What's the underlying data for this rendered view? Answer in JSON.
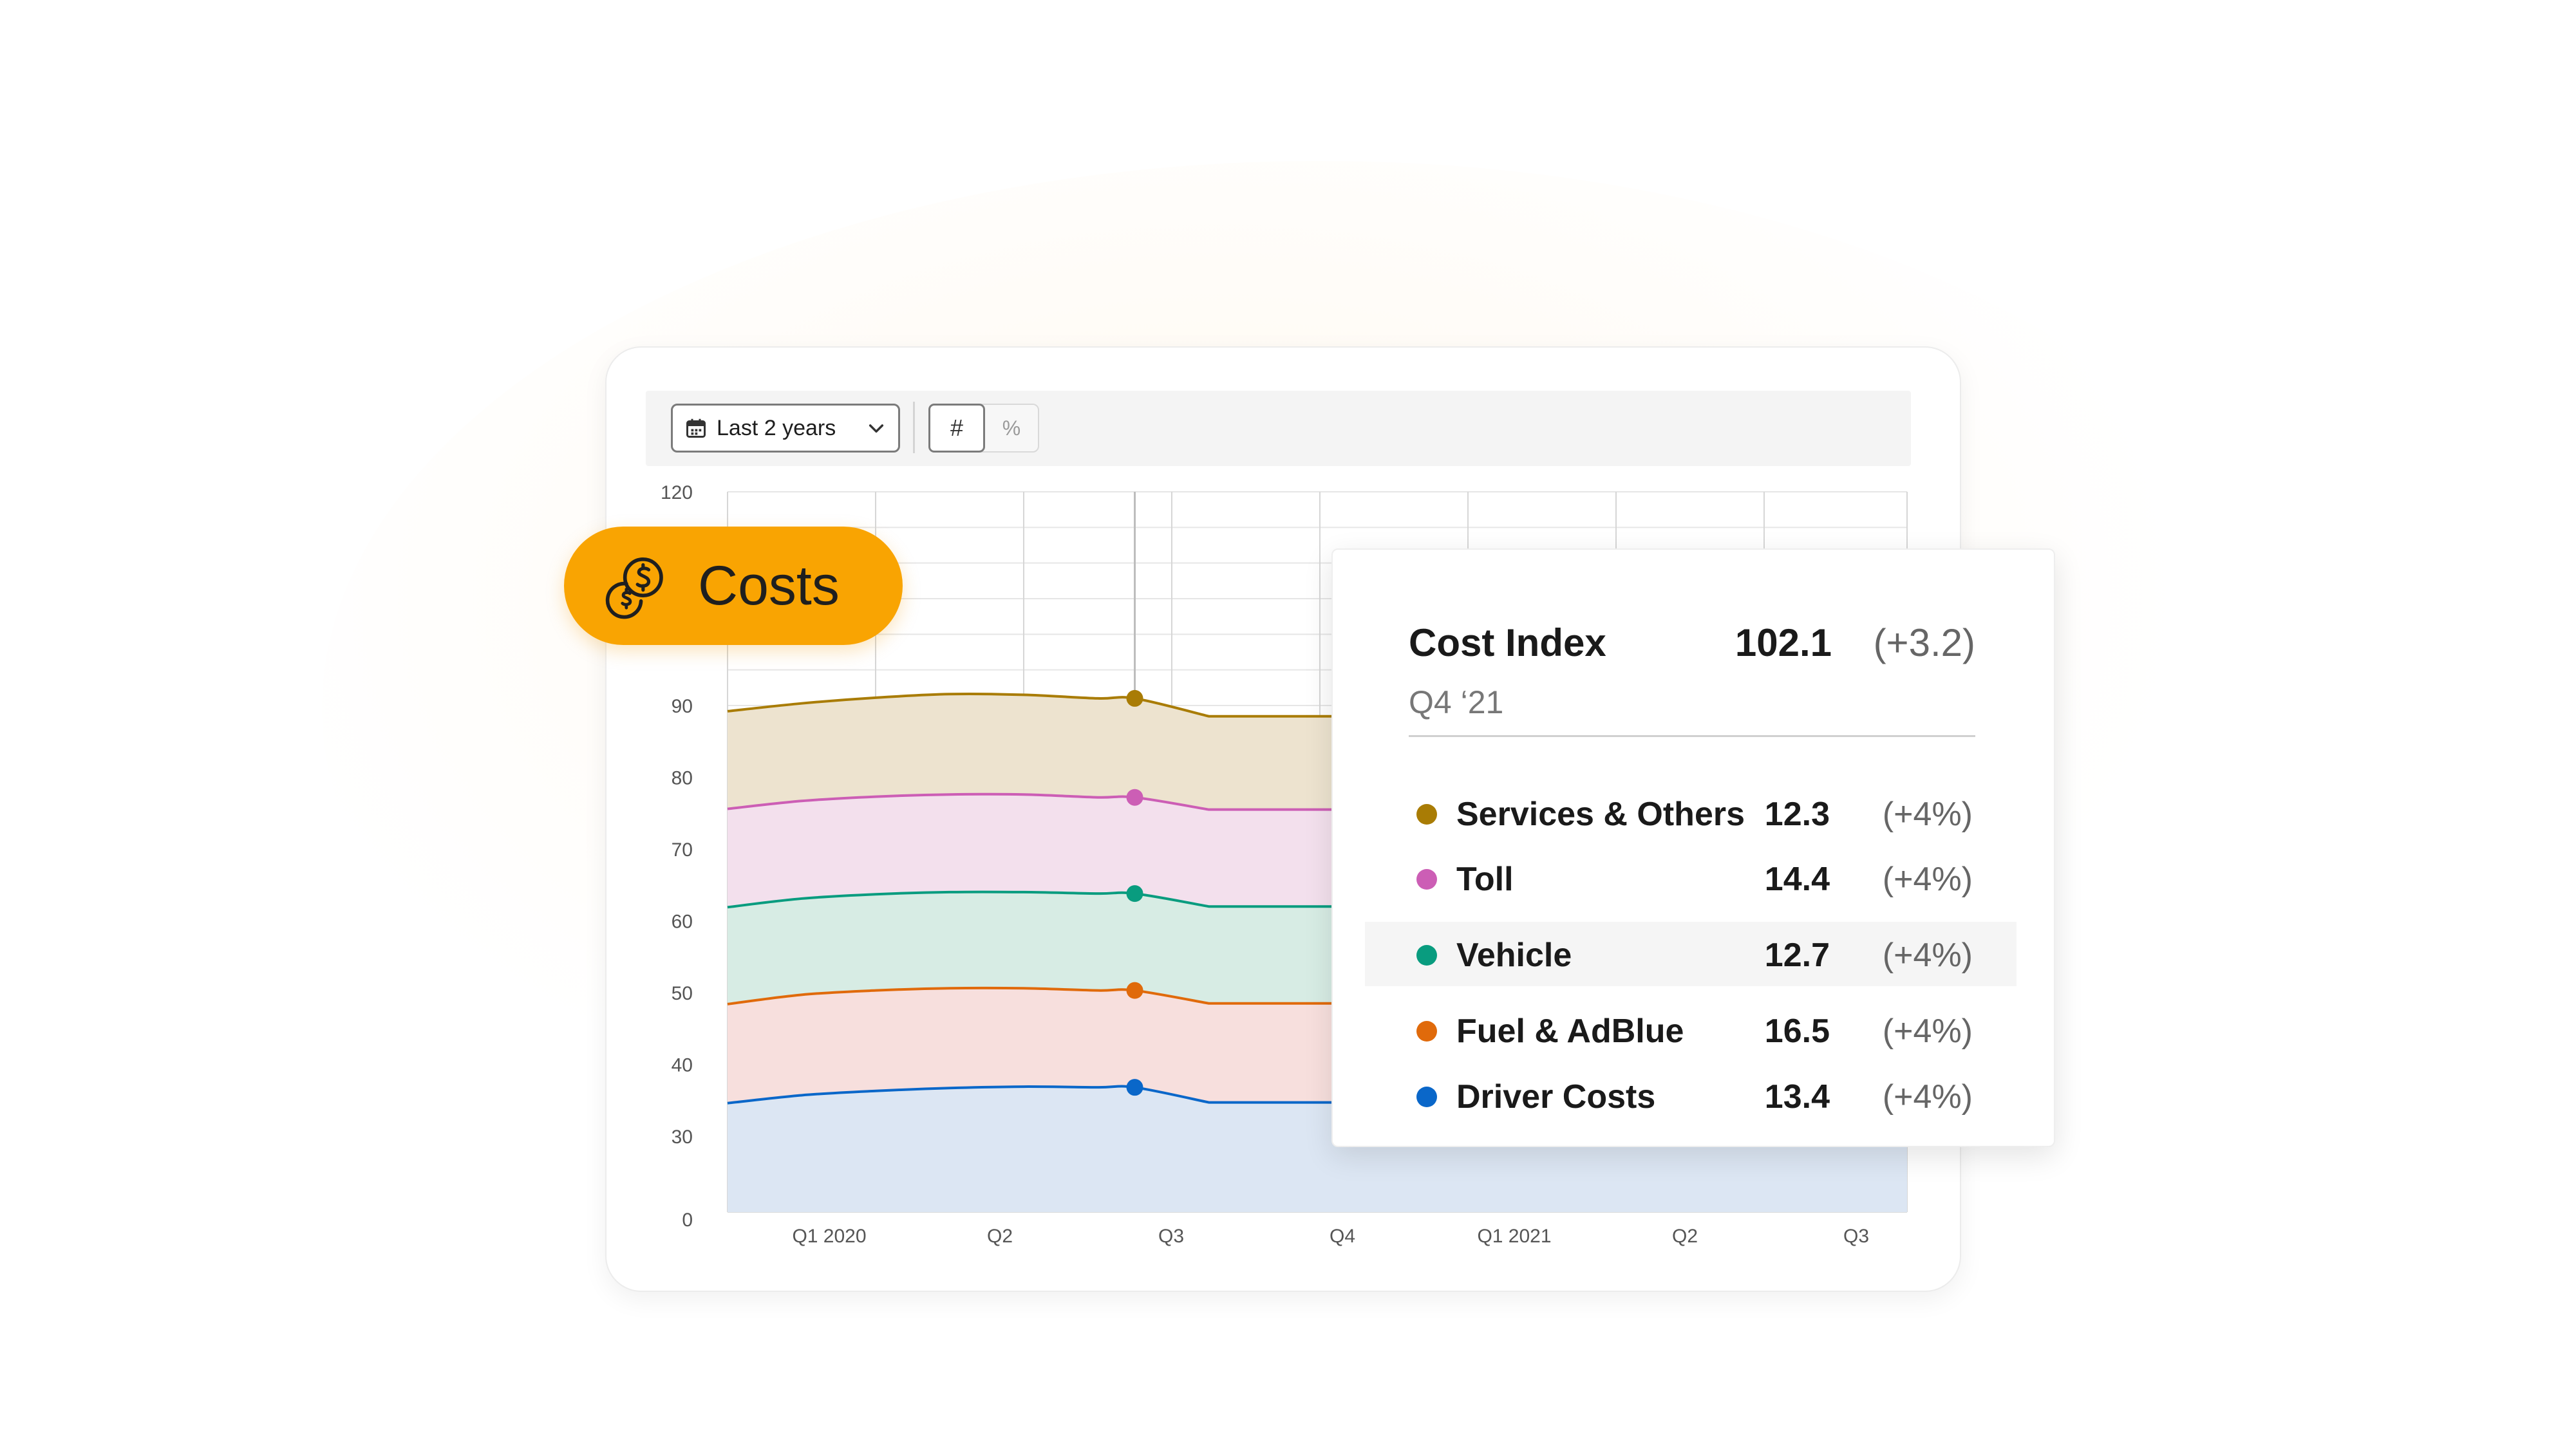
{
  "toolbar": {
    "range_label": "Last 2 years",
    "toggle_number_symbol": "#",
    "toggle_percent_symbol": "%"
  },
  "badge": {
    "label": "Costs"
  },
  "tooltip": {
    "title": "Cost Index",
    "value": "102.1",
    "delta": "(+3.2)",
    "period": "Q4 ‘21",
    "rows": [
      {
        "name": "Services & Others",
        "value": "12.3",
        "change": "(+4%)",
        "color": "#a97c05"
      },
      {
        "name": "Toll",
        "value": "14.4",
        "change": "(+4%)",
        "color": "#cc5eb5"
      },
      {
        "name": "Vehicle",
        "value": "12.7",
        "change": "(+4%)",
        "color": "#099c7f",
        "highlighted": true
      },
      {
        "name": "Fuel & AdBlue",
        "value": "16.5",
        "change": "(+4%)",
        "color": "#e06a0b"
      },
      {
        "name": "Driver Costs",
        "value": "13.4",
        "change": "(+4%)",
        "color": "#0a67c9"
      }
    ]
  },
  "colors": {
    "accent": "#f9a402"
  },
  "chart_data": {
    "type": "area",
    "y_ticks": [
      "0",
      "30",
      "40",
      "50",
      "60",
      "70",
      "80",
      "90",
      "120"
    ],
    "x_ticks": [
      "Q1 2020",
      "Q2",
      "Q3",
      "Q4",
      "Q1 2021",
      "Q2",
      "Q3"
    ],
    "grid": true,
    "ylim": [
      0,
      120
    ],
    "x": [
      0,
      0.5,
      1,
      1.5,
      2,
      2.5,
      2.75,
      3.25
    ],
    "series": [
      {
        "name": "Services & Others",
        "color": "#a97c05",
        "fill": "#ede3cf",
        "values": [
          89.2,
          90.3,
          91.1,
          91.6,
          91.5,
          91.0,
          91.0,
          88.5
        ]
      },
      {
        "name": "Toll",
        "color": "#cc5eb5",
        "fill": "#f3e0ed",
        "values": [
          75.6,
          76.7,
          77.3,
          77.6,
          77.6,
          77.2,
          77.2,
          75.5
        ]
      },
      {
        "name": "Vehicle",
        "color": "#099c7f",
        "fill": "#d7ece4",
        "values": [
          61.9,
          63.1,
          63.7,
          64.0,
          64.0,
          63.8,
          63.8,
          62.0
        ]
      },
      {
        "name": "Fuel & AdBlue",
        "color": "#e06a0b",
        "fill": "#f7dfdd",
        "values": [
          48.4,
          49.7,
          50.3,
          50.6,
          50.6,
          50.3,
          50.3,
          48.5
        ]
      },
      {
        "name": "Driver Costs",
        "color": "#0a67c9",
        "fill": "#dce6f3",
        "values": [
          34.6,
          35.7,
          36.3,
          36.7,
          36.9,
          36.8,
          36.8,
          34.7
        ]
      }
    ],
    "highlight_x": 2.75
  }
}
